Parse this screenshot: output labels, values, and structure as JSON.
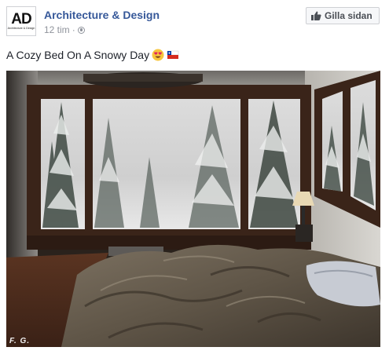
{
  "page": {
    "name": "Architecture & Design",
    "logo": {
      "mark": "AD",
      "sub": "Architecture & Design"
    }
  },
  "post": {
    "time": "12 tim",
    "separator": "·",
    "caption": "A Cozy Bed On A Snowy Day",
    "photo": {
      "subject": "bedroom with unmade bed beside large windows looking out on snowy forest",
      "watermark": "F. G."
    }
  },
  "actions": {
    "like_page_label": "Gilla sidan"
  },
  "icons": {
    "like": "thumbs-up-icon",
    "privacy": "globe-icon",
    "emoji1": "heart-eyes-emoji",
    "emoji2": "chilean-flag-emoji"
  },
  "colors": {
    "link": "#365899",
    "meta": "#90949c",
    "text": "#1d2129",
    "button_bg": "#f6f7f9"
  }
}
